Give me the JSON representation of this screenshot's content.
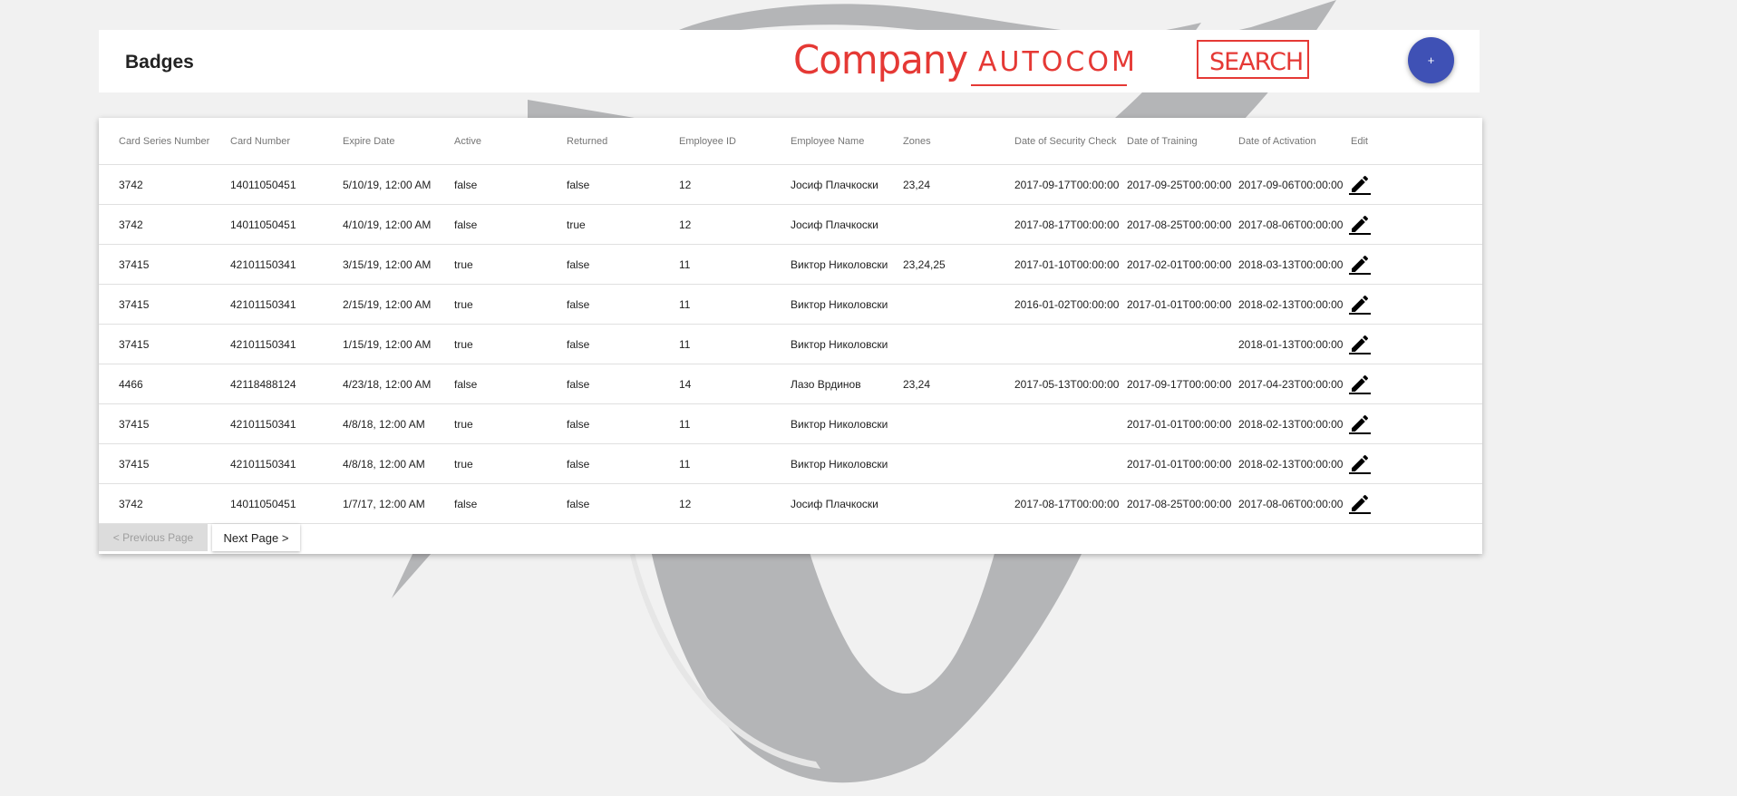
{
  "header": {
    "title": "Badges",
    "company_label": "Company",
    "company_value": "AUTOCOM",
    "search_label": "SEARCH",
    "add_label": "+"
  },
  "table": {
    "columns": [
      "Card Series Number",
      "Card Number",
      "Expire Date",
      "Active",
      "Returned",
      "Employee ID",
      "Employee Name",
      "Zones",
      "Date of Security Check",
      "Date of Training",
      "Date of Activation",
      "Edit"
    ],
    "rows": [
      [
        "3742",
        "14011050451",
        "5/10/19, 12:00 AM",
        "false",
        "false",
        "12",
        "Јосиф Плачкоски",
        "23,24",
        "2017-09-17T00:00:00",
        "2017-09-25T00:00:00",
        "2017-09-06T00:00:00"
      ],
      [
        "3742",
        "14011050451",
        "4/10/19, 12:00 AM",
        "false",
        "true",
        "12",
        "Јосиф Плачкоски",
        "",
        "2017-08-17T00:00:00",
        "2017-08-25T00:00:00",
        "2017-08-06T00:00:00"
      ],
      [
        "37415",
        "42101150341",
        "3/15/19, 12:00 AM",
        "true",
        "false",
        "11",
        "Виктор Николовски",
        "23,24,25",
        "2017-01-10T00:00:00",
        "2017-02-01T00:00:00",
        "2018-03-13T00:00:00"
      ],
      [
        "37415",
        "42101150341",
        "2/15/19, 12:00 AM",
        "true",
        "false",
        "11",
        "Виктор Николовски",
        "",
        "2016-01-02T00:00:00",
        "2017-01-01T00:00:00",
        "2018-02-13T00:00:00"
      ],
      [
        "37415",
        "42101150341",
        "1/15/19, 12:00 AM",
        "true",
        "false",
        "11",
        "Виктор Николовски",
        "",
        "",
        "",
        "2018-01-13T00:00:00"
      ],
      [
        "4466",
        "42118488124",
        "4/23/18, 12:00 AM",
        "false",
        "false",
        "14",
        "Лазо Врдинов",
        "23,24",
        "2017-05-13T00:00:00",
        "2017-09-17T00:00:00",
        "2017-04-23T00:00:00"
      ],
      [
        "37415",
        "42101150341",
        "4/8/18, 12:00 AM",
        "true",
        "false",
        "11",
        "Виктор Николовски",
        "",
        "",
        "2017-01-01T00:00:00",
        "2018-02-13T00:00:00"
      ],
      [
        "37415",
        "42101150341",
        "4/8/18, 12:00 AM",
        "true",
        "false",
        "11",
        "Виктор Николовски",
        "",
        "",
        "2017-01-01T00:00:00",
        "2018-02-13T00:00:00"
      ],
      [
        "3742",
        "14011050451",
        "1/7/17, 12:00 AM",
        "false",
        "false",
        "12",
        "Јосиф Плачкоски",
        "",
        "2017-08-17T00:00:00",
        "2017-08-25T00:00:00",
        "2017-08-06T00:00:00"
      ]
    ]
  },
  "pagination": {
    "prev_label": "< Previous Page",
    "next_label": "Next Page >"
  },
  "colors": {
    "accent": "#3f51b5",
    "annotation": "#e53935",
    "background": "#f1f1f1",
    "watermark": "#b4b5b7"
  },
  "icons": {
    "edit": "pencil-icon",
    "background": "watermark-logo"
  }
}
